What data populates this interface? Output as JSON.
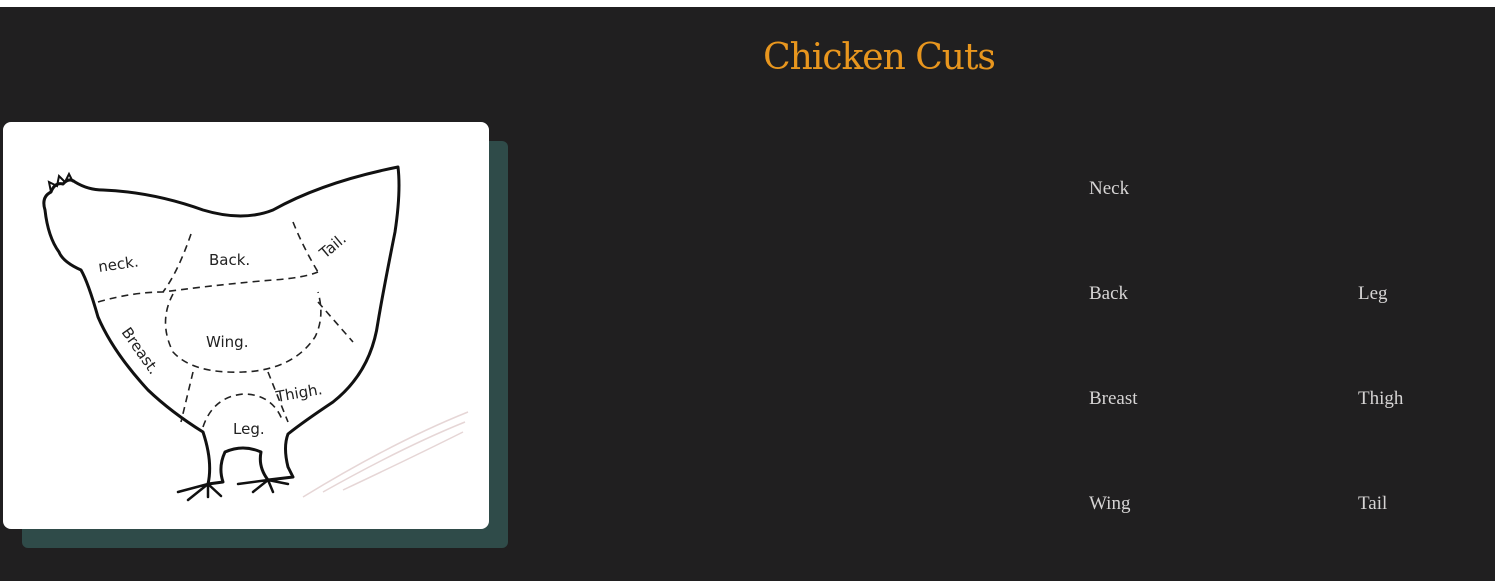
{
  "page": {
    "title": "Chicken Cuts",
    "colors": {
      "background": "#201f20",
      "title": "#e8961e",
      "cut_text": "#d6d4d4",
      "card_shadow": "#2f4b49",
      "card": "#ffffff"
    }
  },
  "diagram": {
    "labels": {
      "neck": "neck.",
      "back": "Back.",
      "tail": "Tail.",
      "wing": "Wing.",
      "breast": "Breast.",
      "thigh": "Thigh.",
      "leg": "Leg."
    }
  },
  "cuts": {
    "neck": "Neck",
    "back": "Back",
    "leg": "Leg",
    "breast": "Breast",
    "thigh": "Thigh",
    "wing": "Wing",
    "tail": "Tail"
  }
}
